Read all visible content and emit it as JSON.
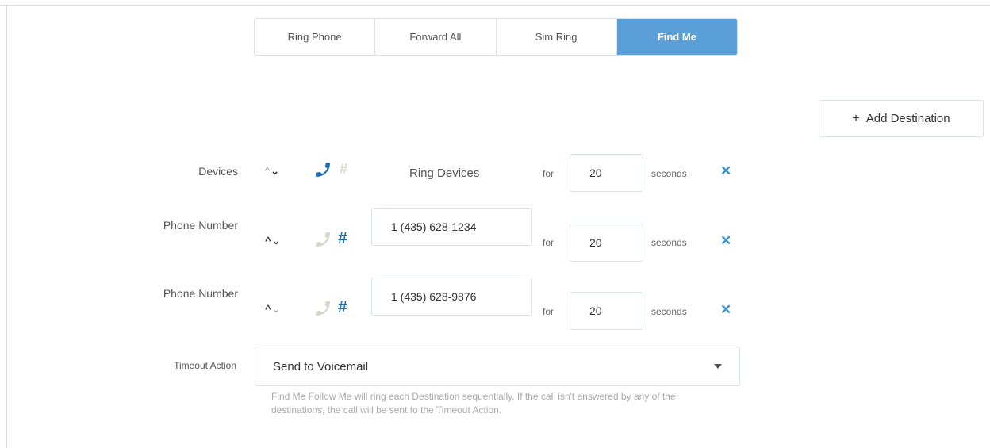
{
  "tabs": [
    {
      "label": "Ring Phone",
      "active": false
    },
    {
      "label": "Forward All",
      "active": false
    },
    {
      "label": "Sim Ring",
      "active": false
    },
    {
      "label": "Find Me",
      "active": true
    }
  ],
  "add_destination": {
    "plus": "+",
    "label": "Add Destination"
  },
  "rows": [
    {
      "label": "Devices",
      "mode": "devices",
      "text": "Ring Devices",
      "for": "for",
      "seconds_value": "20",
      "seconds_label": "seconds"
    },
    {
      "label": "Phone Number",
      "mode": "number",
      "number": "1 (435) 628-1234",
      "for": "for",
      "seconds_value": "20",
      "seconds_label": "seconds"
    },
    {
      "label": "Phone Number",
      "mode": "number",
      "number": "1 (435) 628-9876",
      "for": "for",
      "seconds_value": "20",
      "seconds_label": "seconds"
    }
  ],
  "timeout": {
    "label": "Timeout Action",
    "selected": "Send to Voicemail",
    "help": "Find Me Follow Me will ring each Destination sequentially. If the call isn't answered by any of the destinations, the call will be sent to the Timeout Action."
  },
  "colors": {
    "accent": "#5b9fd8",
    "icon_active": "#1f6fb5",
    "icon_inactive": "#d8d4cc",
    "close": "#3a8fd0"
  }
}
